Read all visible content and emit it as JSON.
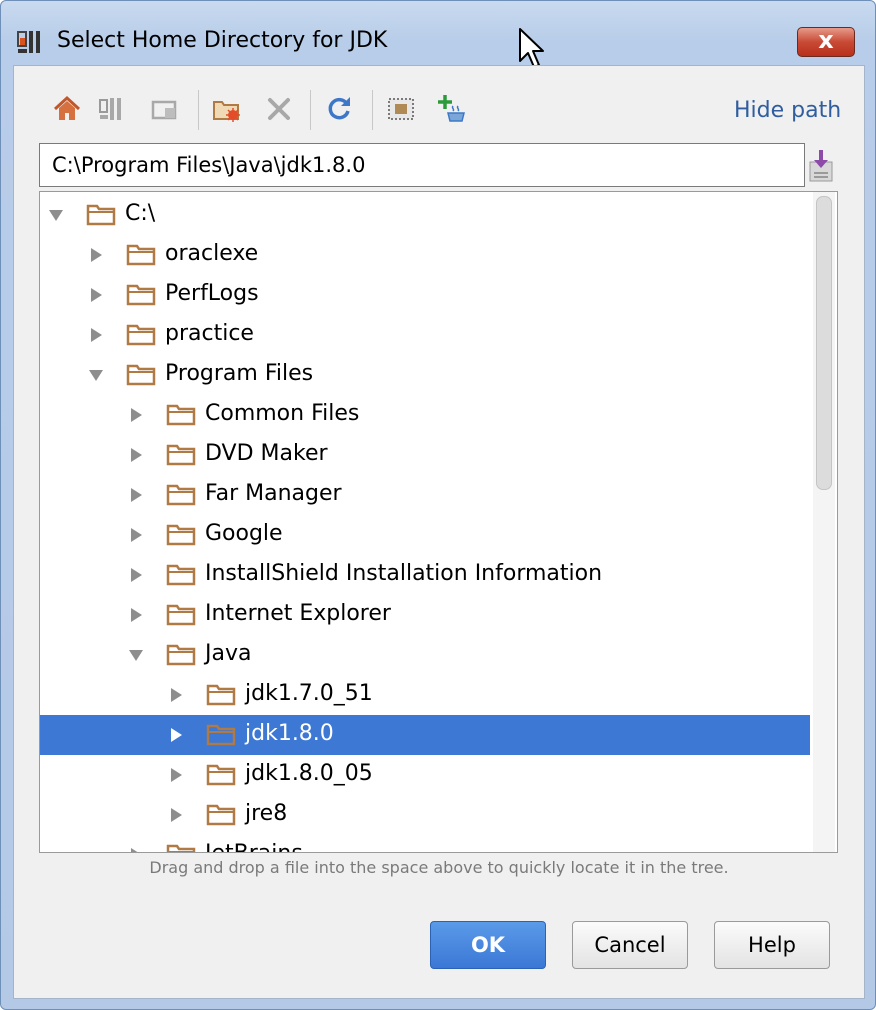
{
  "window": {
    "title": "Select Home Directory for JDK",
    "close_label": "x"
  },
  "toolbar": {
    "icons": [
      "home-icon",
      "project-icon",
      "module-icon",
      "new-folder-icon",
      "delete-icon",
      "refresh-icon",
      "show-hidden-icon",
      "add-sdk-icon"
    ],
    "hide_path_label": "Hide path"
  },
  "path": {
    "value": "C:\\Program Files\\Java\\jdk1.8.0"
  },
  "tree": {
    "items": [
      {
        "label": "C:\\",
        "depth": 0,
        "expanded": true
      },
      {
        "label": "oraclexe",
        "depth": 1,
        "expanded": false
      },
      {
        "label": "PerfLogs",
        "depth": 1,
        "expanded": false
      },
      {
        "label": "practice",
        "depth": 1,
        "expanded": false
      },
      {
        "label": "Program Files",
        "depth": 1,
        "expanded": true
      },
      {
        "label": "Common Files",
        "depth": 2,
        "expanded": false
      },
      {
        "label": "DVD Maker",
        "depth": 2,
        "expanded": false
      },
      {
        "label": "Far Manager",
        "depth": 2,
        "expanded": false
      },
      {
        "label": "Google",
        "depth": 2,
        "expanded": false
      },
      {
        "label": "InstallShield Installation Information",
        "depth": 2,
        "expanded": false
      },
      {
        "label": "Internet Explorer",
        "depth": 2,
        "expanded": false
      },
      {
        "label": "Java",
        "depth": 2,
        "expanded": true
      },
      {
        "label": "jdk1.7.0_51",
        "depth": 3,
        "expanded": false
      },
      {
        "label": "jdk1.8.0",
        "depth": 3,
        "expanded": false,
        "selected": true
      },
      {
        "label": "jdk1.8.0_05",
        "depth": 3,
        "expanded": false
      },
      {
        "label": "jre8",
        "depth": 3,
        "expanded": false
      },
      {
        "label": "JetBrains",
        "depth": 2,
        "expanded": false
      }
    ]
  },
  "hint": "Drag and drop a file into the space above to quickly locate it in the tree.",
  "buttons": {
    "ok": "OK",
    "cancel": "Cancel",
    "help": "Help"
  },
  "colors": {
    "selection": "#3c78d4",
    "folder": "#b07a45",
    "link": "#2f5d9e"
  }
}
